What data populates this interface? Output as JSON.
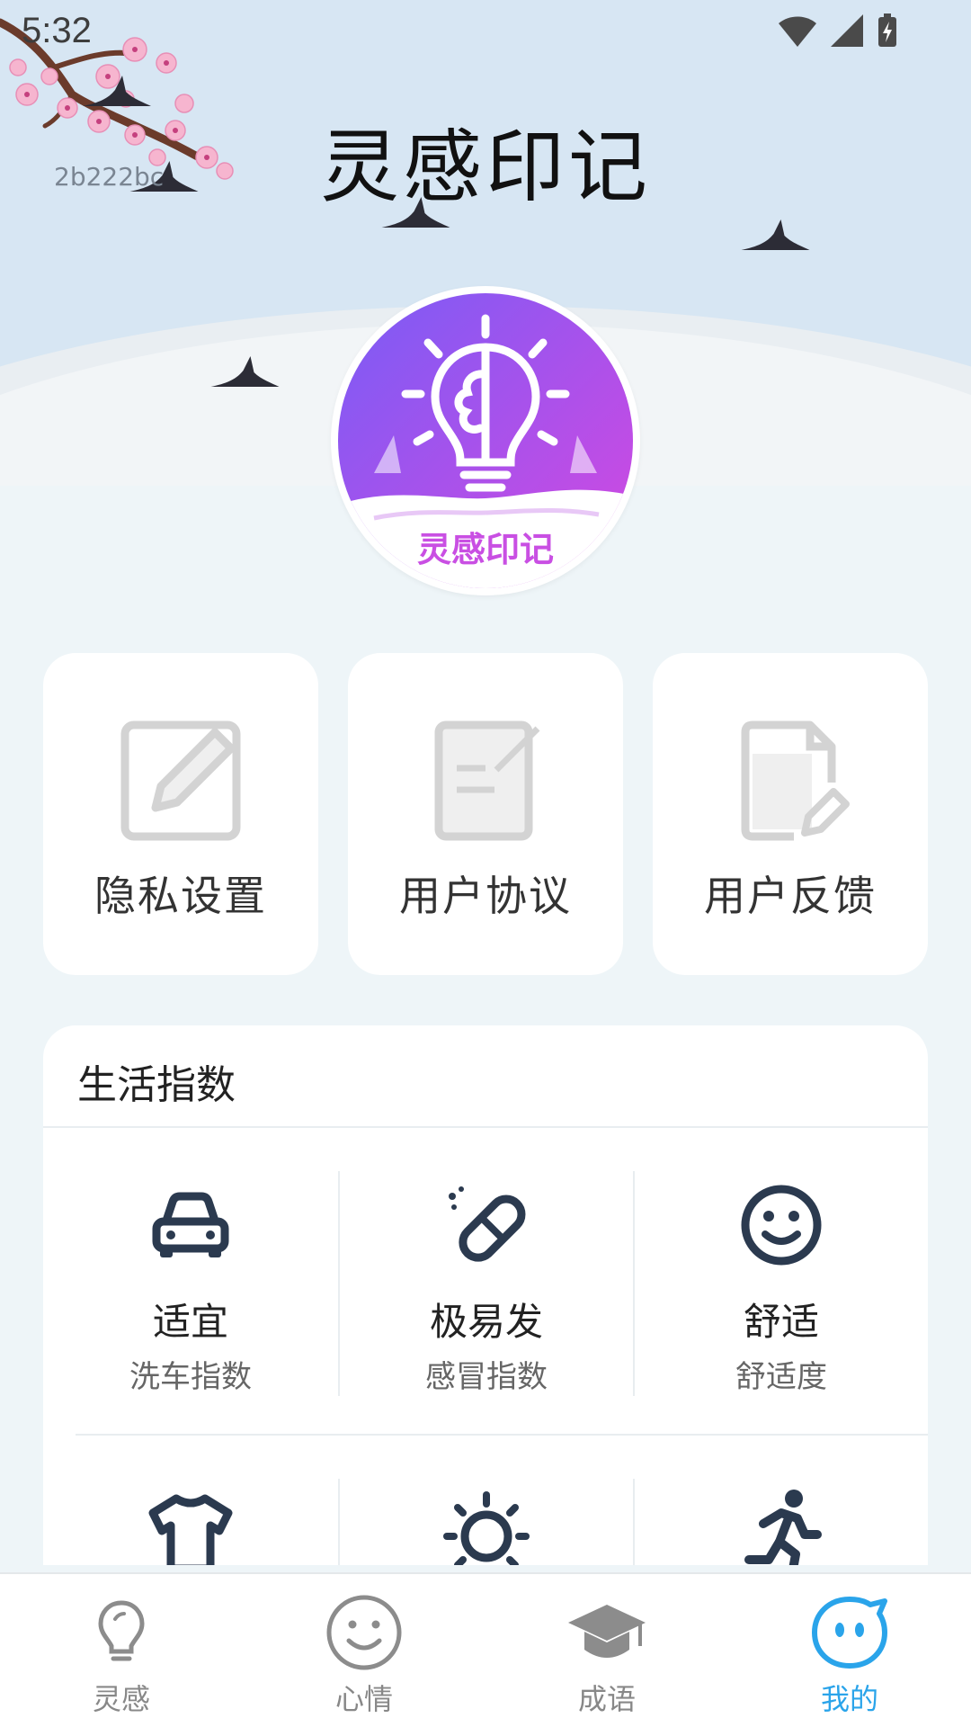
{
  "status_bar": {
    "time": "5:32"
  },
  "header": {
    "app_title": "灵感印记",
    "build_tag": "2b222bc",
    "logo_caption": "灵感印记"
  },
  "settings_cards": [
    {
      "label": "隐私设置",
      "icon": "edit-icon"
    },
    {
      "label": "用户协议",
      "icon": "document-icon"
    },
    {
      "label": "用户反馈",
      "icon": "feedback-icon"
    }
  ],
  "life_index": {
    "title": "生活指数",
    "items": [
      {
        "value": "适宜",
        "name": "洗车指数",
        "icon": "car-icon"
      },
      {
        "value": "极易发",
        "name": "感冒指数",
        "icon": "pill-icon"
      },
      {
        "value": "舒适",
        "name": "舒适度",
        "icon": "smiley-icon"
      },
      {
        "value": "",
        "name": "",
        "icon": "tshirt-icon"
      },
      {
        "value": "",
        "name": "",
        "icon": "sun-icon"
      },
      {
        "value": "",
        "name": "",
        "icon": "running-icon"
      }
    ]
  },
  "tabbar": {
    "active_color": "#2aa4ea",
    "items": [
      {
        "label": "灵感",
        "icon": "lightbulb-icon",
        "active": false
      },
      {
        "label": "心情",
        "icon": "smiley-icon",
        "active": false
      },
      {
        "label": "成语",
        "icon": "graduation-cap-icon",
        "active": false
      },
      {
        "label": "我的",
        "icon": "chat-face-icon",
        "active": true
      }
    ]
  }
}
